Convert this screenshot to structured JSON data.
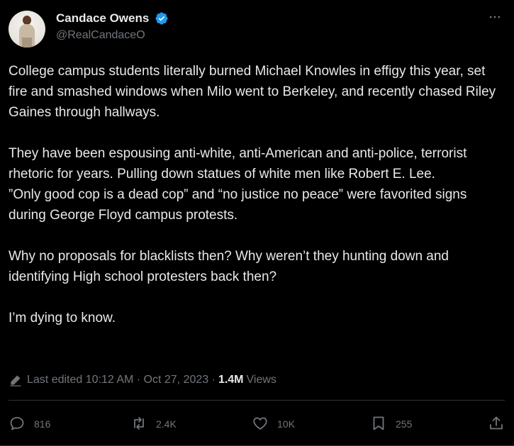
{
  "author": {
    "display_name": "Candace Owens",
    "handle": "@RealCandaceO",
    "verified": true
  },
  "tweet": {
    "text": "College campus students literally burned Michael Knowles in effigy this year, set fire and smashed windows when Milo went to Berkeley, and recently chased Riley Gaines through hallways.\n\nThey have been espousing anti-white, anti-American and anti-police, terrorist rhetoric for years. Pulling down statues of white men like Robert E. Lee.\n”Only good cop is a dead cop” and “no justice no peace” were favorited signs during George Floyd campus protests.\n\nWhy no proposals for blacklists then? Why weren’t they hunting down and identifying High school protesters back then?\n\nI’m dying to know.",
    "edited_label": "Last edited 10:12 AM · Oct 27, 2023 ·",
    "views_count": "1.4M",
    "views_label": "Views"
  },
  "actions": {
    "replies": "816",
    "reposts": "2.4K",
    "likes": "10K",
    "bookmarks": "255"
  },
  "icons": {
    "more": "more-options-icon",
    "edit": "pencil-icon",
    "reply": "reply-icon",
    "repost": "repost-icon",
    "like": "heart-icon",
    "bookmark": "bookmark-icon",
    "share": "share-icon",
    "verified": "verified-badge-icon"
  },
  "colors": {
    "background": "#000000",
    "text": "#e7e9ea",
    "muted": "#71767b",
    "verified": "#1d9bf0",
    "divider": "#2f3336"
  }
}
